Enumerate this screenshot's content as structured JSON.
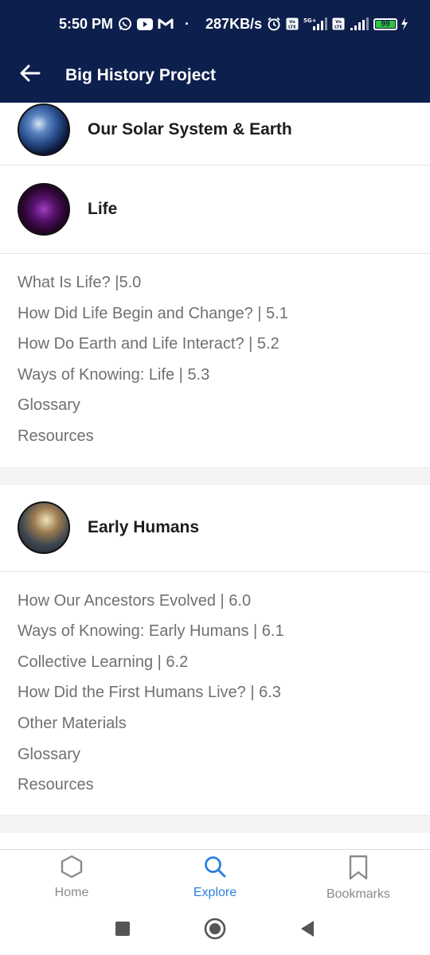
{
  "status_bar": {
    "time": "5:50 PM",
    "dot": "·",
    "speed": "287KB/s",
    "battery": "99",
    "icons": [
      "whatsapp-icon",
      "youtube-icon",
      "gmail-icon",
      "alarm-icon",
      "volte-icon",
      "5g-signal-icon",
      "volte-icon",
      "signal-icon",
      "battery-icon",
      "charging-icon"
    ]
  },
  "app_bar": {
    "title": "Big History Project"
  },
  "sections": [
    {
      "title": "Our Solar System & Earth",
      "image": "earth-image",
      "items": []
    },
    {
      "title": "Life",
      "image": "cells-image",
      "items": [
        "What Is Life? |5.0",
        "How Did Life Begin and Change? | 5.1",
        "How Do Earth and Life Interact? | 5.2",
        "Ways of Knowing: Life | 5.3",
        "Glossary",
        "Resources"
      ]
    },
    {
      "title": "Early Humans",
      "image": "early-humans-image",
      "items": [
        "How Our Ancestors Evolved | 6.0",
        "Ways of Knowing: Early Humans | 6.1",
        "Collective Learning | 6.2",
        "How Did the First Humans Live? | 6.3",
        "Other Materials",
        "Glossary",
        "Resources"
      ]
    }
  ],
  "bottom_nav": {
    "home": "Home",
    "explore": "Explore",
    "bookmarks": "Bookmarks",
    "active": "explore"
  },
  "colors": {
    "header_bg": "#0d1f4c",
    "accent": "#2b7fe0",
    "link_text": "#707070",
    "battery_green": "#31c43b"
  }
}
